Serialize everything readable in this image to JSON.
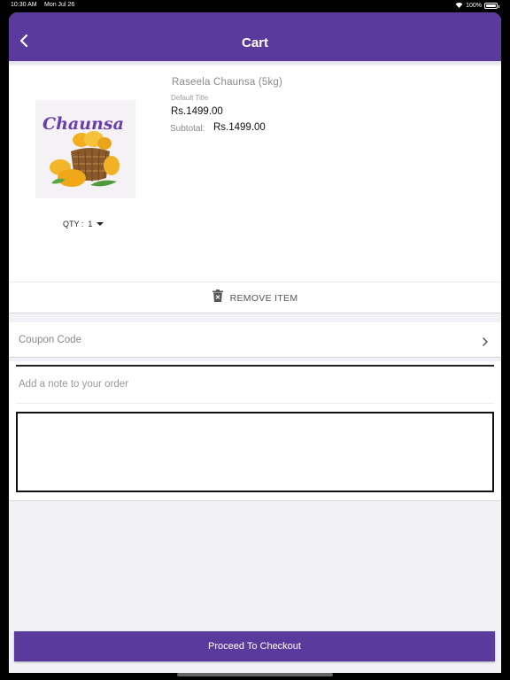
{
  "status_bar": {
    "time": "10:30 AM",
    "date": "Mon Jul 26",
    "battery": "100%"
  },
  "nav": {
    "title": "Cart",
    "back_icon": "chevron-left-icon"
  },
  "cart_item": {
    "image_text": "Chaunsa",
    "name": "Raseela Chaunsa (5kg)",
    "variant": "Default Title",
    "price": "Rs.1499.00",
    "subtotal_label": "Subtotal:",
    "subtotal_value": "Rs.1499.00",
    "qty_label": "QTY :",
    "qty_value": "1",
    "remove_label": "REMOVE ITEM"
  },
  "coupon": {
    "label": "Coupon Code"
  },
  "note": {
    "label": "Add a note to your order",
    "value": ""
  },
  "checkout": {
    "label": "Proceed To Checkout"
  },
  "colors": {
    "brand": "#5b3a9e",
    "background": "#f2f1f5",
    "image_text": "#6a3db0"
  }
}
